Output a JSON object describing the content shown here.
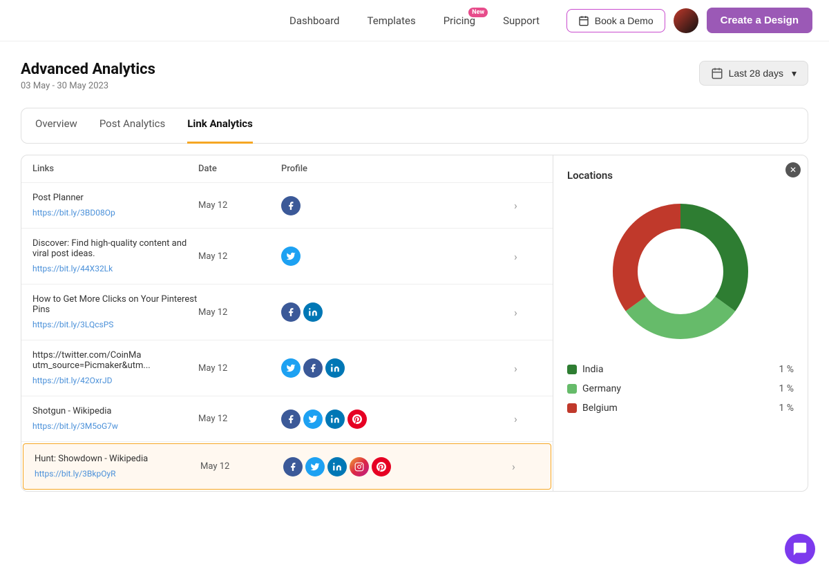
{
  "nav": {
    "links": [
      {
        "id": "dashboard",
        "label": "Dashboard"
      },
      {
        "id": "templates",
        "label": "Templates"
      },
      {
        "id": "pricing",
        "label": "Pricing",
        "badge": "New"
      },
      {
        "id": "support",
        "label": "Support"
      }
    ],
    "book_demo_label": "Book a Demo",
    "create_design_label": "Create a Design"
  },
  "page": {
    "title": "Advanced Analytics",
    "date_range": "03 May - 30 May 2023",
    "date_picker_label": "Last 28 days"
  },
  "tabs": [
    {
      "id": "overview",
      "label": "Overview",
      "active": false
    },
    {
      "id": "post-analytics",
      "label": "Post Analytics",
      "active": false
    },
    {
      "id": "link-analytics",
      "label": "Link Analytics",
      "active": true
    }
  ],
  "table": {
    "columns": [
      "Links",
      "Date",
      "Profile",
      ""
    ],
    "rows": [
      {
        "title": "Post Planner",
        "url": "https://bit.ly/3BD08Op",
        "date": "May 12",
        "profiles": [
          "fb"
        ],
        "highlighted": false
      },
      {
        "title": "Discover: Find high-quality content and viral post ideas.",
        "url": "https://bit.ly/44X32Lk",
        "date": "May 12",
        "profiles": [
          "tw"
        ],
        "highlighted": false
      },
      {
        "title": "How to Get More Clicks on Your Pinterest Pins",
        "url": "https://bit.ly/3LQcsPS",
        "date": "May 12",
        "profiles": [
          "fb",
          "li"
        ],
        "highlighted": false
      },
      {
        "title": "https://twitter.com/CoinMa utm_source=Picmaker&utm...",
        "url": "https://bit.ly/42OxrJD",
        "date": "May 12",
        "profiles": [
          "tw",
          "fb",
          "li"
        ],
        "highlighted": false
      },
      {
        "title": "Shotgun - Wikipedia",
        "url": "https://bit.ly/3M5oG7w",
        "date": "May 12",
        "profiles": [
          "fb",
          "tw",
          "li",
          "pi"
        ],
        "highlighted": false
      },
      {
        "title": "Hunt: Showdown - Wikipedia",
        "url": "https://bit.ly/3BkpOyR",
        "date": "May 12",
        "profiles": [
          "fb",
          "tw",
          "li",
          "ig",
          "pi"
        ],
        "highlighted": true
      }
    ]
  },
  "locations": {
    "title": "Locations",
    "chart": {
      "segments": [
        {
          "label": "India",
          "color": "#2e7d32",
          "pct": 35,
          "startAngle": 0
        },
        {
          "label": "Germany",
          "color": "#66bb6a",
          "pct": 30,
          "startAngle": 35
        },
        {
          "label": "Belgium",
          "color": "#c0392b",
          "pct": 35,
          "startAngle": 65
        }
      ]
    },
    "legend": [
      {
        "label": "India",
        "color": "#2e7d32",
        "pct": "1 %"
      },
      {
        "label": "Germany",
        "color": "#66bb6a",
        "pct": "1 %"
      },
      {
        "label": "Belgium",
        "color": "#c0392b",
        "pct": "1 %"
      }
    ]
  }
}
